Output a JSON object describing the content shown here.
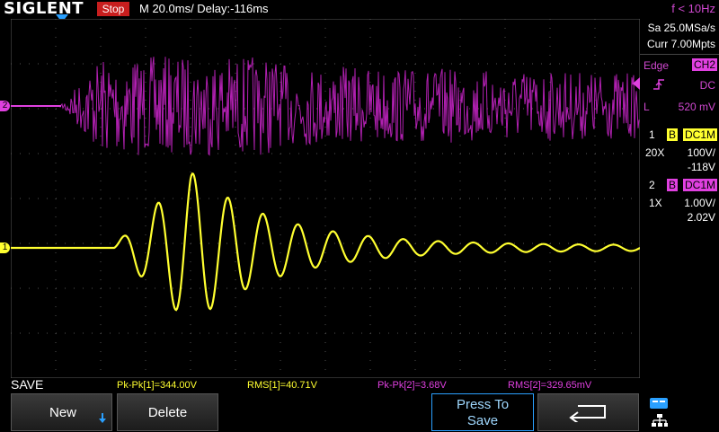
{
  "header": {
    "brand": "SIGLENT",
    "status": "Stop",
    "timebase": "M 20.0ms/ Delay:-116ms",
    "frequency": "f < 10Hz"
  },
  "acquisition": {
    "sample_rate": "Sa 25.0MSa/s",
    "memory_depth": "Curr 7.00Mpts"
  },
  "trigger": {
    "type": "Edge",
    "source": "CH2",
    "coupling": "DC",
    "level_label": "L",
    "level": "520 mV"
  },
  "channels": [
    {
      "num": "1",
      "bw": "B",
      "coupling": "DC1M",
      "probe": "20X",
      "scale": "100V/",
      "offset": "-118V",
      "color": "#ffff30"
    },
    {
      "num": "2",
      "bw": "B",
      "coupling": "DC1M",
      "probe": "1X",
      "scale": "1.00V/",
      "offset": "2.02V",
      "color": "#e040e0"
    }
  ],
  "markers": {
    "ch1": "1",
    "ch2": "2"
  },
  "measurements": [
    {
      "label": "Pk-Pk[1]=344.00V",
      "color": "#ffff30"
    },
    {
      "label": "RMS[1]=40.71V",
      "color": "#ffff30"
    },
    {
      "label": "Pk-Pk[2]=3.68V",
      "color": "#e040e0"
    },
    {
      "label": "RMS[2]=329.65mV",
      "color": "#e040e0"
    }
  ],
  "menu": {
    "title": "SAVE",
    "new_label": "New",
    "delete_label": "Delete",
    "press_to_label": "Press To",
    "save_label": "Save"
  }
}
